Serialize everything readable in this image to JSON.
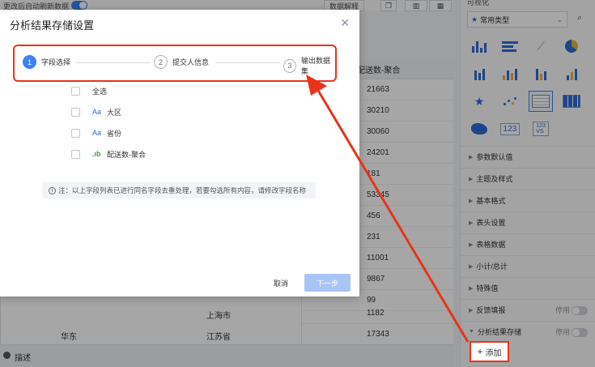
{
  "topbar": {
    "auto_refresh_label": "更改后自动刷新数据",
    "explain_button": "数据解释"
  },
  "table": {
    "column_header": "配送数-聚合",
    "values": [
      "21663",
      "30210",
      "30060",
      "24201",
      "181",
      "53345",
      "456",
      "231",
      "11001",
      "9867",
      "99",
      "1182",
      "17343"
    ],
    "city_cell": "上海市",
    "region_cell": "华东",
    "province_cell": "江苏省"
  },
  "describe_bar": {
    "label": "描述"
  },
  "right_panel": {
    "title": "可视化",
    "chart_type_select": "常用类型",
    "number_icon_text": "123",
    "sections": [
      {
        "label": "参数默认值"
      },
      {
        "label": "主题及样式"
      },
      {
        "label": "基本格式"
      },
      {
        "label": "表头设置"
      },
      {
        "label": "表格数据"
      },
      {
        "label": "小计/总计"
      },
      {
        "label": "特殊值"
      },
      {
        "label": "反馈填报",
        "state": "停用"
      },
      {
        "label": "分析结果存储",
        "state": "停用"
      }
    ],
    "add_button": "添加"
  },
  "dialog": {
    "title": "分析结果存储设置",
    "steps": [
      {
        "num": "1",
        "label": "字段选择"
      },
      {
        "num": "2",
        "label": "提交人信息"
      },
      {
        "num": "3",
        "label": "输出数据集"
      }
    ],
    "fields": [
      {
        "type": "",
        "label": "全选"
      },
      {
        "type": "Aa",
        "label": "大区"
      },
      {
        "type": "Aa",
        "label": "省份"
      },
      {
        "type": ".ıb",
        "label": "配送数-聚合"
      }
    ],
    "notice": "注：以上字段列表已进行同名字段去重处理，若要勾选所有内容，请修改字段名称",
    "cancel_label": "取消",
    "next_label": "下一步"
  },
  "colors": {
    "accent": "#3c82f6",
    "highlight": "#e8341c"
  }
}
